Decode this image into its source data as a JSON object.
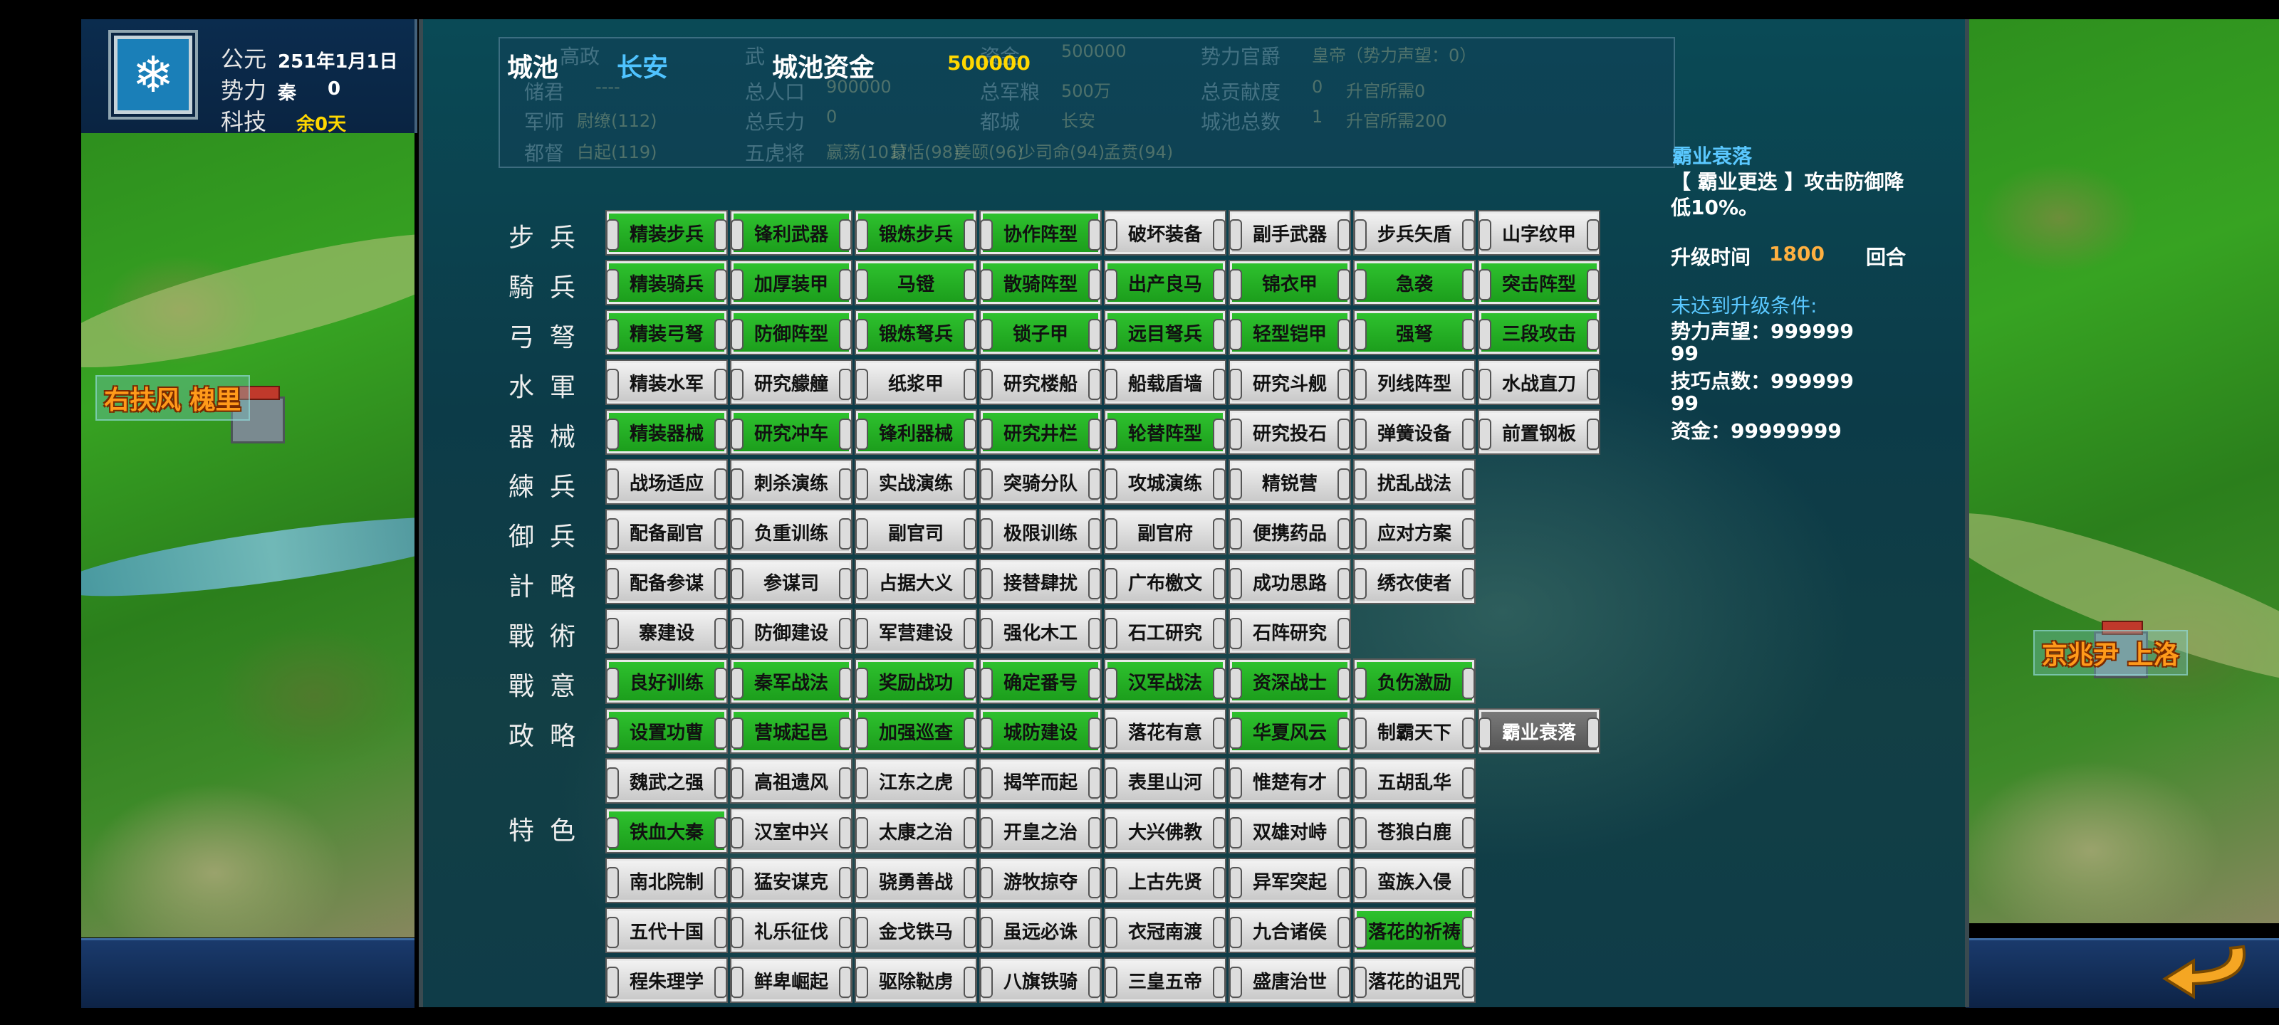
{
  "hud": {
    "era_label": "公元",
    "date": "251年1月1日",
    "power_label": "势力",
    "power_value": "秦",
    "power_num": "0",
    "tech_label": "科技",
    "tech_remain": "余0天"
  },
  "city": {
    "label": "城池",
    "name": "长安",
    "funds_label": "城池资金",
    "funds_value": "500000"
  },
  "faded_info": {
    "r1": [
      "高政",
      "武",
      "资金",
      "500000",
      "势力官爵",
      "皇帝（势力声望：0）"
    ],
    "r2": [
      "储君",
      "----",
      "总人口",
      "900000",
      "总军粮",
      "500万",
      "总贡献度",
      "0",
      "升官所需0"
    ],
    "r3": [
      "军师",
      "尉缭(112)",
      "总兵力",
      "0",
      "都城",
      "长安",
      "城池总数",
      "1",
      "升官所需200"
    ],
    "r4": [
      "都督",
      "白起(119)",
      "五虎将",
      "嬴荡(101)",
      "蒙恬(98)",
      "姜颐(96)",
      "少司命(94)",
      "孟贲(94)"
    ]
  },
  "categories": [
    "步兵",
    "騎兵",
    "弓弩",
    "水軍",
    "器械",
    "練兵",
    "御兵",
    "計略",
    "戰術",
    "戰意",
    "政略",
    "特色"
  ],
  "grid": [
    [
      [
        "精装步兵",
        "g"
      ],
      [
        "锋利武器",
        "g"
      ],
      [
        "锻炼步兵",
        "g"
      ],
      [
        "协作阵型",
        "g"
      ],
      [
        "破坏装备",
        "w"
      ],
      [
        "副手武器",
        "w"
      ],
      [
        "步兵矢盾",
        "w"
      ],
      [
        "山字纹甲",
        "w"
      ]
    ],
    [
      [
        "精装骑兵",
        "g"
      ],
      [
        "加厚装甲",
        "g"
      ],
      [
        "马镫",
        "g"
      ],
      [
        "散骑阵型",
        "g"
      ],
      [
        "出产良马",
        "g"
      ],
      [
        "锦衣甲",
        "g"
      ],
      [
        "急袭",
        "g"
      ],
      [
        "突击阵型",
        "g"
      ]
    ],
    [
      [
        "精装弓弩",
        "g"
      ],
      [
        "防御阵型",
        "g"
      ],
      [
        "锻炼弩兵",
        "g"
      ],
      [
        "锁子甲",
        "g"
      ],
      [
        "远目弩兵",
        "g"
      ],
      [
        "轻型铠甲",
        "g"
      ],
      [
        "强弩",
        "g"
      ],
      [
        "三段攻击",
        "g"
      ]
    ],
    [
      [
        "精装水军",
        "w"
      ],
      [
        "研究艨艟",
        "w"
      ],
      [
        "纸浆甲",
        "w"
      ],
      [
        "研究楼船",
        "w"
      ],
      [
        "船载盾墙",
        "w"
      ],
      [
        "研究斗舰",
        "w"
      ],
      [
        "列线阵型",
        "w"
      ],
      [
        "水战直刀",
        "w"
      ]
    ],
    [
      [
        "精装器械",
        "g"
      ],
      [
        "研究冲车",
        "g"
      ],
      [
        "锋利器械",
        "g"
      ],
      [
        "研究井栏",
        "g"
      ],
      [
        "轮替阵型",
        "g"
      ],
      [
        "研究投石",
        "w"
      ],
      [
        "弹簧设备",
        "w"
      ],
      [
        "前置钢板",
        "w"
      ]
    ],
    [
      [
        "战场适应",
        "w"
      ],
      [
        "刺杀演练",
        "w"
      ],
      [
        "实战演练",
        "w"
      ],
      [
        "突骑分队",
        "w"
      ],
      [
        "攻城演练",
        "w"
      ],
      [
        "精锐营",
        "w"
      ],
      [
        "扰乱战法",
        "w"
      ]
    ],
    [
      [
        "配备副官",
        "w"
      ],
      [
        "负重训练",
        "w"
      ],
      [
        "副官司",
        "w"
      ],
      [
        "极限训练",
        "w"
      ],
      [
        "副官府",
        "w"
      ],
      [
        "便携药品",
        "w"
      ],
      [
        "应对方案",
        "w"
      ]
    ],
    [
      [
        "配备参谋",
        "w"
      ],
      [
        "参谋司",
        "w"
      ],
      [
        "占据大义",
        "w"
      ],
      [
        "接替肆扰",
        "w"
      ],
      [
        "广布檄文",
        "w"
      ],
      [
        "成功思路",
        "w"
      ],
      [
        "绣衣使者",
        "w"
      ]
    ],
    [
      [
        "寨建设",
        "w"
      ],
      [
        "防御建设",
        "w"
      ],
      [
        "军营建设",
        "w"
      ],
      [
        "强化木工",
        "w"
      ],
      [
        "石工研究",
        "w"
      ],
      [
        "石阵研究",
        "w"
      ]
    ],
    [
      [
        "良好训练",
        "g"
      ],
      [
        "秦军战法",
        "g"
      ],
      [
        "奖励战功",
        "g"
      ],
      [
        "确定番号",
        "g"
      ],
      [
        "汉军战法",
        "g"
      ],
      [
        "资深战士",
        "g"
      ],
      [
        "负伤激励",
        "g"
      ]
    ],
    [
      [
        "设置功曹",
        "g"
      ],
      [
        "营城起邑",
        "g"
      ],
      [
        "加强巡查",
        "g"
      ],
      [
        "城防建设",
        "g"
      ],
      [
        "落花有意",
        "w"
      ],
      [
        "华夏风云",
        "g"
      ],
      [
        "制霸天下",
        "w"
      ],
      [
        "霸业衰落",
        "d"
      ]
    ],
    [
      [
        "魏武之强",
        "w"
      ],
      [
        "高祖遗风",
        "w"
      ],
      [
        "江东之虎",
        "w"
      ],
      [
        "揭竿而起",
        "w"
      ],
      [
        "表里山河",
        "w"
      ],
      [
        "惟楚有才",
        "w"
      ],
      [
        "五胡乱华",
        "w"
      ]
    ],
    [
      [
        "铁血大秦",
        "g"
      ],
      [
        "汉室中兴",
        "w"
      ],
      [
        "太康之治",
        "w"
      ],
      [
        "开皇之治",
        "w"
      ],
      [
        "大兴佛教",
        "w"
      ],
      [
        "双雄对峙",
        "w"
      ],
      [
        "苍狼白鹿",
        "w"
      ]
    ],
    [
      [
        "南北院制",
        "w"
      ],
      [
        "猛安谋克",
        "w"
      ],
      [
        "骁勇善战",
        "w"
      ],
      [
        "游牧掠夺",
        "w"
      ],
      [
        "上古先贤",
        "w"
      ],
      [
        "异军突起",
        "w"
      ],
      [
        "蛮族入侵",
        "w"
      ]
    ],
    [
      [
        "五代十国",
        "w"
      ],
      [
        "礼乐征伐",
        "w"
      ],
      [
        "金戈铁马",
        "w"
      ],
      [
        "虽远必诛",
        "w"
      ],
      [
        "衣冠南渡",
        "w"
      ],
      [
        "九合诸侯",
        "w"
      ],
      [
        "落花的祈祷",
        "g"
      ]
    ],
    [
      [
        "程朱理学",
        "w"
      ],
      [
        "鲜卑崛起",
        "w"
      ],
      [
        "驱除鞑虏",
        "w"
      ],
      [
        "八旗铁骑",
        "w"
      ],
      [
        "三皇五帝",
        "w"
      ],
      [
        "盛唐治世",
        "w"
      ],
      [
        "落花的诅咒",
        "w"
      ]
    ]
  ],
  "detail": {
    "title": "霸业衰落",
    "desc1": "【 霸业更迭 】攻击防御降",
    "desc2": "低10%。",
    "time_label": "升级时间",
    "time_value": "1800",
    "time_unit": "回合",
    "cond_title": "未达到升级条件:",
    "cond1a": "势力声望：999999",
    "cond1b": "99",
    "cond2a": "技巧点数：999999",
    "cond2b": "99",
    "cond3": "资金：99999999"
  },
  "map": {
    "left_city": "右扶风 槐里",
    "right_city": "京兆尹 上洛"
  },
  "colors": {
    "researched": "#22b022",
    "available": "#dcdcdc",
    "selected": "#666666",
    "highlight_yellow": "#ffd700",
    "city_blue": "#4fc3ff",
    "detail_blue": "#5ac8ff"
  }
}
